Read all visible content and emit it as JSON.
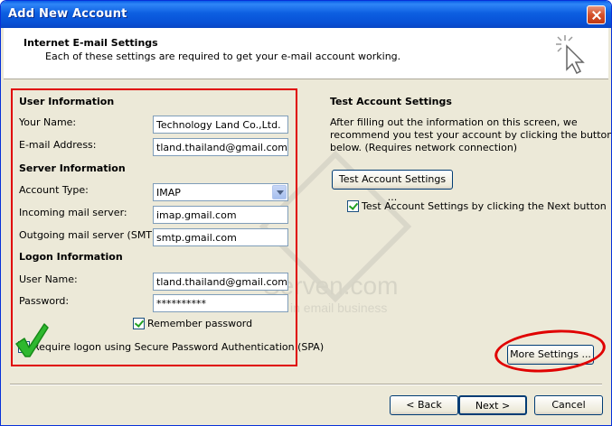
{
  "window": {
    "title": "Add New Account"
  },
  "header": {
    "title": "Internet E-mail Settings",
    "subtitle": "Each of these settings are required to get your e-mail account working."
  },
  "user_info": {
    "heading": "User Information",
    "name_label": "Your Name:",
    "name_value": "Technology Land Co.,Ltd.",
    "email_label": "E-mail Address:",
    "email_value": "tland.thailand@gmail.com"
  },
  "server_info": {
    "heading": "Server Information",
    "account_type_label": "Account Type:",
    "account_type_value": "IMAP",
    "incoming_label": "Incoming mail server:",
    "incoming_value": "imap.gmail.com",
    "outgoing_label": "Outgoing mail server (SMTP):",
    "outgoing_value": "smtp.gmail.com"
  },
  "logon_info": {
    "heading": "Logon Information",
    "username_label": "User Name:",
    "username_value": "tland.thailand@gmail.com",
    "password_label": "Password:",
    "password_value": "**********",
    "remember_label": "Remember password",
    "remember_checked": true,
    "spa_label": "Require logon using Secure Password Authentication (SPA)",
    "spa_checked": false
  },
  "test_settings": {
    "heading": "Test Account Settings",
    "description_line1": "After filling out the information on this screen, we",
    "description_line2": "recommend you test your account by clicking the button",
    "description_line3": "below. (Requires network connection)",
    "test_button": "Test Account Settings ...",
    "auto_test_label": "Test Account Settings by clicking the Next button",
    "auto_test_checked": true
  },
  "more_settings_button": "More Settings ...",
  "footer": {
    "back": "< Back",
    "next": "Next >",
    "cancel": "Cancel"
  },
  "watermark": {
    "line1": "Serven.com",
    "line2": "in email business"
  },
  "icons": {
    "close": "close-icon",
    "wizard": "wizard-cursor-icon",
    "dropdown": "chevron-down-icon",
    "annotation_check": "green-checkmark-icon"
  },
  "colors": {
    "titlebar": "#0a5fe8",
    "dialog": "#ece9d8",
    "annotation": "#e00000",
    "check": "#21a121"
  }
}
